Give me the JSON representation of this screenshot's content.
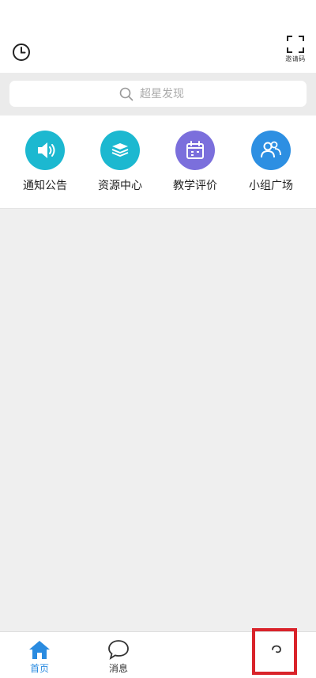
{
  "header": {
    "history_icon": "clock-icon",
    "invite": {
      "label": "邀请码",
      "icon": "scan-frame-icon"
    }
  },
  "search": {
    "placeholder": "超星发现",
    "icon": "search-icon"
  },
  "apps": [
    {
      "label": "通知公告",
      "icon": "megaphone-icon",
      "color": "#1cb8d0"
    },
    {
      "label": "资源中心",
      "icon": "books-icon",
      "color": "#1cb8d0"
    },
    {
      "label": "教学评价",
      "icon": "calendar-icon",
      "color": "#7b6fdc"
    },
    {
      "label": "小组广场",
      "icon": "group-icon",
      "color": "#2d8fe2"
    }
  ],
  "tabbar": {
    "tabs": [
      {
        "label": "首页",
        "icon": "home-icon",
        "active": true
      },
      {
        "label": "消息",
        "icon": "chat-bubble-icon",
        "active": false
      },
      {
        "label": "",
        "icon": "profile-icon",
        "active": false
      }
    ],
    "active_color": "#2a8be0",
    "inactive_color": "#333333",
    "highlight_color": "#d9232a"
  }
}
